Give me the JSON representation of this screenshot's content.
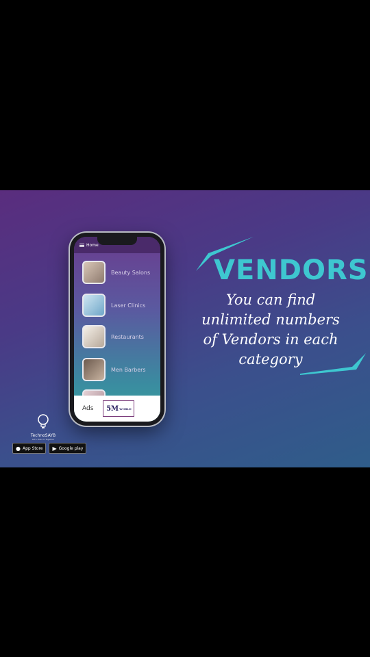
{
  "phone": {
    "app_title": "Home",
    "categories": [
      {
        "label": "Beauty Salons"
      },
      {
        "label": "Laser Clinics"
      },
      {
        "label": "Restaurants"
      },
      {
        "label": "Men Barbers"
      },
      {
        "label": ""
      }
    ],
    "ads_label": "Ads",
    "ad_logo_text": "5M",
    "ad_logo_sub": "WORLD"
  },
  "promo": {
    "headline": "VENDORS",
    "line1": "You can find",
    "line2": "unlimited numbers",
    "line3": "of Vendors in each category"
  },
  "branding": {
    "name": "TechnoSAYB",
    "tagline": "Let's Build It Together",
    "app_store_label": "App Store",
    "google_play_label": "Google play"
  },
  "colors": {
    "accent": "#3ec7d0",
    "banner_start": "#5a2d7e",
    "banner_end": "#2f5d8a"
  }
}
